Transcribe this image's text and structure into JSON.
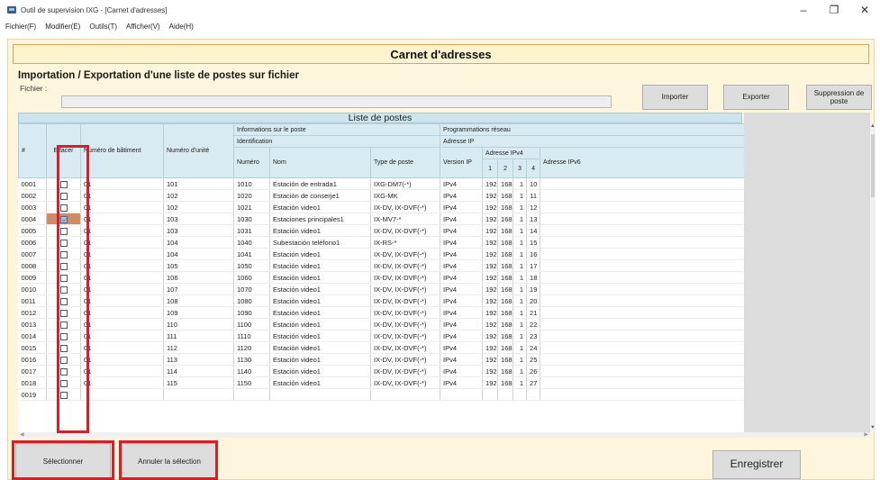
{
  "window": {
    "title": "Outil de supervision IXG - [Carnet d'adresses]",
    "controls": {
      "minimize": "–",
      "restore": "❐",
      "close": "✕"
    }
  },
  "menu": [
    "Fichier(F)",
    "Modifier(E)",
    "Outils(T)",
    "Afficher(V)",
    "Aide(H)"
  ],
  "banner": "Carnet d'adresses",
  "import_export": {
    "title": "Importation / Exportation d'une liste de postes sur fichier",
    "file_label": "Fichier :",
    "file_value": "",
    "import_label": "Importer",
    "export_label": "Exporter",
    "delete_label": "Suppression de poste"
  },
  "list": {
    "title": "Liste de postes",
    "headers": {
      "num": "#",
      "effacer": "Effacer",
      "batiment": "Numéro de bâtiment",
      "unite": "Numéro d'unité",
      "info_poste": "Informations sur le poste",
      "identification": "Identification",
      "numero": "Numéro",
      "nom": "Nom",
      "type": "Type de poste",
      "prog_reseau": "Programmations réseau",
      "adresse_ip": "Adresse IP",
      "version_ip": "Version IP",
      "adresse_ipv4": "Adresse IPv4",
      "o1": "1",
      "o2": "2",
      "o3": "3",
      "o4": "4",
      "adresse_ipv6": "Adresse IPv6"
    },
    "rows": [
      {
        "id": "0001",
        "checked": false,
        "bat": "01",
        "unit": "101",
        "num": "1010",
        "nom": "Estación de entrada1",
        "type": "IXG-DM7(-*)",
        "ver": "IPv4",
        "o1": "192",
        "o2": "168",
        "o3": "1",
        "o4": "10",
        "ipv6": ""
      },
      {
        "id": "0002",
        "checked": false,
        "bat": "01",
        "unit": "102",
        "num": "1020",
        "nom": "Estación de conserje1",
        "type": "IXG-MK",
        "ver": "IPv4",
        "o1": "192",
        "o2": "168",
        "o3": "1",
        "o4": "11",
        "ipv6": ""
      },
      {
        "id": "0003",
        "checked": false,
        "bat": "01",
        "unit": "102",
        "num": "1021",
        "nom": "Estación video1",
        "type": "IX-DV, IX-DVF(-*)",
        "ver": "IPv4",
        "o1": "192",
        "o2": "168",
        "o3": "1",
        "o4": "12",
        "ipv6": ""
      },
      {
        "id": "0004",
        "checked": true,
        "bat": "01",
        "unit": "103",
        "num": "1030",
        "nom": "Estaciones principales1",
        "type": "IX-MV7-*",
        "ver": "IPv4",
        "o1": "192",
        "o2": "168",
        "o3": "1",
        "o4": "13",
        "ipv6": ""
      },
      {
        "id": "0005",
        "checked": false,
        "bat": "01",
        "unit": "103",
        "num": "1031",
        "nom": "Estación video1",
        "type": "IX-DV, IX-DVF(-*)",
        "ver": "IPv4",
        "o1": "192",
        "o2": "168",
        "o3": "1",
        "o4": "14",
        "ipv6": ""
      },
      {
        "id": "0006",
        "checked": false,
        "bat": "01",
        "unit": "104",
        "num": "1040",
        "nom": "Subestación teléfono1",
        "type": "IX-RS-*",
        "ver": "IPv4",
        "o1": "192",
        "o2": "168",
        "o3": "1",
        "o4": "15",
        "ipv6": ""
      },
      {
        "id": "0007",
        "checked": false,
        "bat": "01",
        "unit": "104",
        "num": "1041",
        "nom": "Estación video1",
        "type": "IX-DV, IX-DVF(-*)",
        "ver": "IPv4",
        "o1": "192",
        "o2": "168",
        "o3": "1",
        "o4": "16",
        "ipv6": ""
      },
      {
        "id": "0008",
        "checked": false,
        "bat": "01",
        "unit": "105",
        "num": "1050",
        "nom": "Estación video1",
        "type": "IX-DV, IX-DVF(-*)",
        "ver": "IPv4",
        "o1": "192",
        "o2": "168",
        "o3": "1",
        "o4": "17",
        "ipv6": ""
      },
      {
        "id": "0009",
        "checked": false,
        "bat": "01",
        "unit": "106",
        "num": "1060",
        "nom": "Estación video1",
        "type": "IX-DV, IX-DVF(-*)",
        "ver": "IPv4",
        "o1": "192",
        "o2": "168",
        "o3": "1",
        "o4": "18",
        "ipv6": ""
      },
      {
        "id": "0010",
        "checked": false,
        "bat": "01",
        "unit": "107",
        "num": "1070",
        "nom": "Estación video1",
        "type": "IX-DV, IX-DVF(-*)",
        "ver": "IPv4",
        "o1": "192",
        "o2": "168",
        "o3": "1",
        "o4": "19",
        "ipv6": ""
      },
      {
        "id": "0011",
        "checked": false,
        "bat": "01",
        "unit": "108",
        "num": "1080",
        "nom": "Estación video1",
        "type": "IX-DV, IX-DVF(-*)",
        "ver": "IPv4",
        "o1": "192",
        "o2": "168",
        "o3": "1",
        "o4": "20",
        "ipv6": ""
      },
      {
        "id": "0012",
        "checked": false,
        "bat": "01",
        "unit": "109",
        "num": "1090",
        "nom": "Estación video1",
        "type": "IX-DV, IX-DVF(-*)",
        "ver": "IPv4",
        "o1": "192",
        "o2": "168",
        "o3": "1",
        "o4": "21",
        "ipv6": ""
      },
      {
        "id": "0013",
        "checked": false,
        "bat": "01",
        "unit": "110",
        "num": "1100",
        "nom": "Estación video1",
        "type": "IX-DV, IX-DVF(-*)",
        "ver": "IPv4",
        "o1": "192",
        "o2": "168",
        "o3": "1",
        "o4": "22",
        "ipv6": ""
      },
      {
        "id": "0014",
        "checked": false,
        "bat": "01",
        "unit": "111",
        "num": "1110",
        "nom": "Estación video1",
        "type": "IX-DV, IX-DVF(-*)",
        "ver": "IPv4",
        "o1": "192",
        "o2": "168",
        "o3": "1",
        "o4": "23",
        "ipv6": ""
      },
      {
        "id": "0015",
        "checked": false,
        "bat": "01",
        "unit": "112",
        "num": "1120",
        "nom": "Estación video1",
        "type": "IX-DV, IX-DVF(-*)",
        "ver": "IPv4",
        "o1": "192",
        "o2": "168",
        "o3": "1",
        "o4": "24",
        "ipv6": ""
      },
      {
        "id": "0016",
        "checked": false,
        "bat": "01",
        "unit": "113",
        "num": "1130",
        "nom": "Estación video1",
        "type": "IX-DV, IX-DVF(-*)",
        "ver": "IPv4",
        "o1": "192",
        "o2": "168",
        "o3": "1",
        "o4": "25",
        "ipv6": ""
      },
      {
        "id": "0017",
        "checked": false,
        "bat": "01",
        "unit": "114",
        "num": "1140",
        "nom": "Estación video1",
        "type": "IX-DV, IX-DVF(-*)",
        "ver": "IPv4",
        "o1": "192",
        "o2": "168",
        "o3": "1",
        "o4": "26",
        "ipv6": ""
      },
      {
        "id": "0018",
        "checked": false,
        "bat": "01",
        "unit": "115",
        "num": "1150",
        "nom": "Estación video1",
        "type": "IX-DV, IX-DVF(-*)",
        "ver": "IPv4",
        "o1": "192",
        "o2": "168",
        "o3": "1",
        "o4": "27",
        "ipv6": ""
      },
      {
        "id": "0019",
        "checked": false,
        "bat": "",
        "unit": "",
        "num": "",
        "nom": "",
        "type": "",
        "ver": "",
        "o1": "",
        "o2": "",
        "o3": "",
        "o4": "",
        "ipv6": ""
      }
    ]
  },
  "scrollbars": {
    "up": "▲",
    "down": "▼",
    "left": "◀",
    "right": "▶"
  },
  "buttons": {
    "select": "Sélectionner",
    "cancel": "Annuler la sélection",
    "save": "Enregistrer"
  },
  "colors": {
    "panel_bg": "#fdf5dc",
    "header_bg": "#d8eaf2",
    "highlight": "#d4202a",
    "checked_row": "#d08a66"
  }
}
